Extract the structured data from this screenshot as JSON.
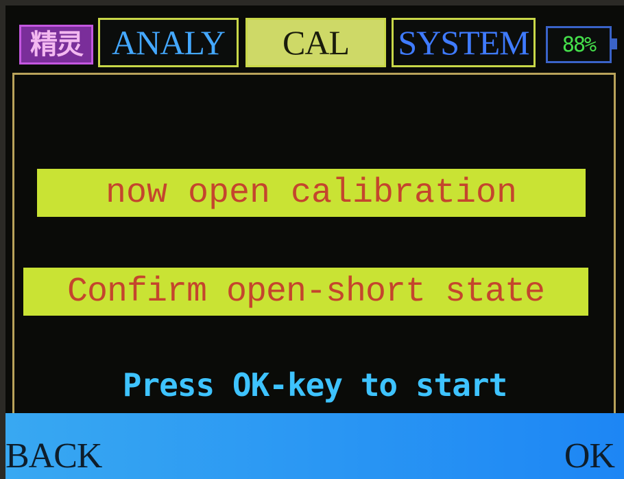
{
  "header": {
    "logo_glyph": "精灵",
    "tabs": [
      {
        "label": "ANALY",
        "active": false
      },
      {
        "label": "CAL",
        "active": true
      },
      {
        "label": "SYSTEM",
        "active": false
      }
    ],
    "battery": {
      "label": "88%",
      "level": 0.88
    }
  },
  "main": {
    "line1": "now open calibration",
    "line2": "Confirm open-short state",
    "hint": "Press OK-key to start"
  },
  "footer": {
    "left_key": "BACK",
    "right_key": "OK"
  },
  "colors": {
    "tab_border": "#c9d848",
    "active_tab_bg": "#ced967",
    "banner_bg": "#c9e334",
    "banner_text": "#c4452d",
    "hint_text": "#3ec3ff",
    "footer_bg": "#1d86f4",
    "battery_text": "#45e04b"
  }
}
